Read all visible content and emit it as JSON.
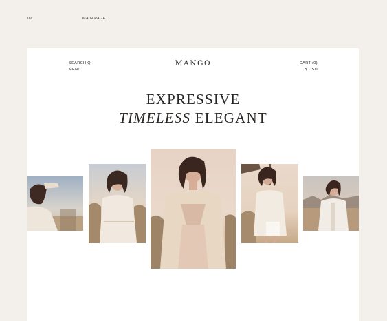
{
  "meta": {
    "page_number": "02",
    "page_label": "MAIN PAGE"
  },
  "header": {
    "search_label": "SEARCH Q",
    "menu_label": "MENU",
    "brand": "MANGO",
    "cart_label": "CART (0)",
    "currency_label": "$ USD"
  },
  "hero": {
    "line1": "EXPRESSIVE",
    "line2_italic": "TIMELESS",
    "line2_rest": "ELEGANT"
  },
  "gallery": {
    "images": [
      {
        "icon": "model-photo-icon",
        "description": "woman in white blouse, desert sky"
      },
      {
        "icon": "model-photo-icon",
        "description": "woman in white lace dress, desert"
      },
      {
        "icon": "model-photo-icon",
        "description": "woman in beige blazer and pleated dress"
      },
      {
        "icon": "model-photo-icon",
        "description": "woman in white blouse and shorts"
      },
      {
        "icon": "model-photo-icon",
        "description": "woman in white jacket, mountains"
      }
    ]
  },
  "colors": {
    "background": "#f3efea",
    "card": "#ffffff",
    "text": "#2a2623"
  }
}
